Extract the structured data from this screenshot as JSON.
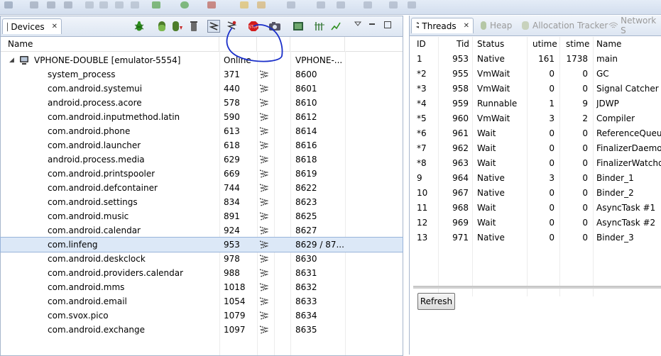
{
  "devices_view": {
    "tab_label": "Devices",
    "columns": [
      "Name",
      "",
      "",
      ""
    ],
    "device": {
      "name": "VPHONE-DOUBLE [emulator-5554]",
      "status": "Online",
      "serial": "VPHONE-..."
    },
    "processes": [
      {
        "name": "system_process",
        "pid": "371",
        "port": "8600"
      },
      {
        "name": "com.android.systemui",
        "pid": "440",
        "port": "8601"
      },
      {
        "name": "android.process.acore",
        "pid": "578",
        "port": "8610"
      },
      {
        "name": "com.android.inputmethod.latin",
        "pid": "590",
        "port": "8612"
      },
      {
        "name": "com.android.phone",
        "pid": "613",
        "port": "8614"
      },
      {
        "name": "com.android.launcher",
        "pid": "618",
        "port": "8616"
      },
      {
        "name": "android.process.media",
        "pid": "629",
        "port": "8618"
      },
      {
        "name": "com.android.printspooler",
        "pid": "669",
        "port": "8619"
      },
      {
        "name": "com.android.defcontainer",
        "pid": "744",
        "port": "8622"
      },
      {
        "name": "com.android.settings",
        "pid": "834",
        "port": "8623"
      },
      {
        "name": "com.android.music",
        "pid": "891",
        "port": "8625"
      },
      {
        "name": "com.android.calendar",
        "pid": "924",
        "port": "8627"
      },
      {
        "name": "com.linfeng",
        "pid": "953",
        "port": "8629 / 87...",
        "selected": true
      },
      {
        "name": "com.android.deskclock",
        "pid": "978",
        "port": "8630"
      },
      {
        "name": "com.android.providers.calendar",
        "pid": "988",
        "port": "8631"
      },
      {
        "name": "com.android.mms",
        "pid": "1018",
        "port": "8632"
      },
      {
        "name": "com.android.email",
        "pid": "1054",
        "port": "8633"
      },
      {
        "name": "com.svox.pico",
        "pid": "1079",
        "port": "8634"
      },
      {
        "name": "com.android.exchange",
        "pid": "1097",
        "port": "8635"
      }
    ]
  },
  "right_tabs": {
    "threads": "Threads",
    "heap": "Heap",
    "allocation": "Allocation Tracker",
    "network": "Network S"
  },
  "threads": {
    "columns": [
      "ID",
      "Tid",
      "Status",
      "utime",
      "stime",
      "Name"
    ],
    "rows": [
      {
        "id": "1",
        "tid": "953",
        "status": "Native",
        "utime": "161",
        "stime": "1738",
        "name": "main"
      },
      {
        "id": "*2",
        "tid": "955",
        "status": "VmWait",
        "utime": "0",
        "stime": "0",
        "name": "GC"
      },
      {
        "id": "*3",
        "tid": "958",
        "status": "VmWait",
        "utime": "0",
        "stime": "0",
        "name": "Signal Catcher"
      },
      {
        "id": "*4",
        "tid": "959",
        "status": "Runnable",
        "utime": "1",
        "stime": "9",
        "name": "JDWP"
      },
      {
        "id": "*5",
        "tid": "960",
        "status": "VmWait",
        "utime": "3",
        "stime": "2",
        "name": "Compiler"
      },
      {
        "id": "*6",
        "tid": "961",
        "status": "Wait",
        "utime": "0",
        "stime": "0",
        "name": "ReferenceQueue"
      },
      {
        "id": "*7",
        "tid": "962",
        "status": "Wait",
        "utime": "0",
        "stime": "0",
        "name": "FinalizerDaemon"
      },
      {
        "id": "*8",
        "tid": "963",
        "status": "Wait",
        "utime": "0",
        "stime": "0",
        "name": "FinalizerWatchd"
      },
      {
        "id": "9",
        "tid": "964",
        "status": "Native",
        "utime": "3",
        "stime": "0",
        "name": "Binder_1"
      },
      {
        "id": "10",
        "tid": "967",
        "status": "Native",
        "utime": "0",
        "stime": "0",
        "name": "Binder_2"
      },
      {
        "id": "11",
        "tid": "968",
        "status": "Wait",
        "utime": "0",
        "stime": "0",
        "name": "AsyncTask #1"
      },
      {
        "id": "12",
        "tid": "969",
        "status": "Wait",
        "utime": "0",
        "stime": "0",
        "name": "AsyncTask #2"
      },
      {
        "id": "13",
        "tid": "971",
        "status": "Native",
        "utime": "0",
        "stime": "0",
        "name": "Binder_3"
      }
    ],
    "refresh_label": "Refresh"
  },
  "icons": [
    "debug-icon",
    "update-heap-icon",
    "dump-hprof-icon",
    "cause-gc-icon",
    "update-threads-icon",
    "start-method-profiling-icon",
    "stop-process-icon",
    "screen-capture-icon",
    "dump-view-hierarchy-icon",
    "systrace-icon",
    "opengl-trace-icon",
    "view-menu-icon",
    "minimize-icon",
    "maximize-icon"
  ],
  "colors": {
    "selection": "#dce8f7",
    "stop": "#d21c1c",
    "annotation": "#1a2fc9",
    "debug": "#2f8f1e"
  }
}
